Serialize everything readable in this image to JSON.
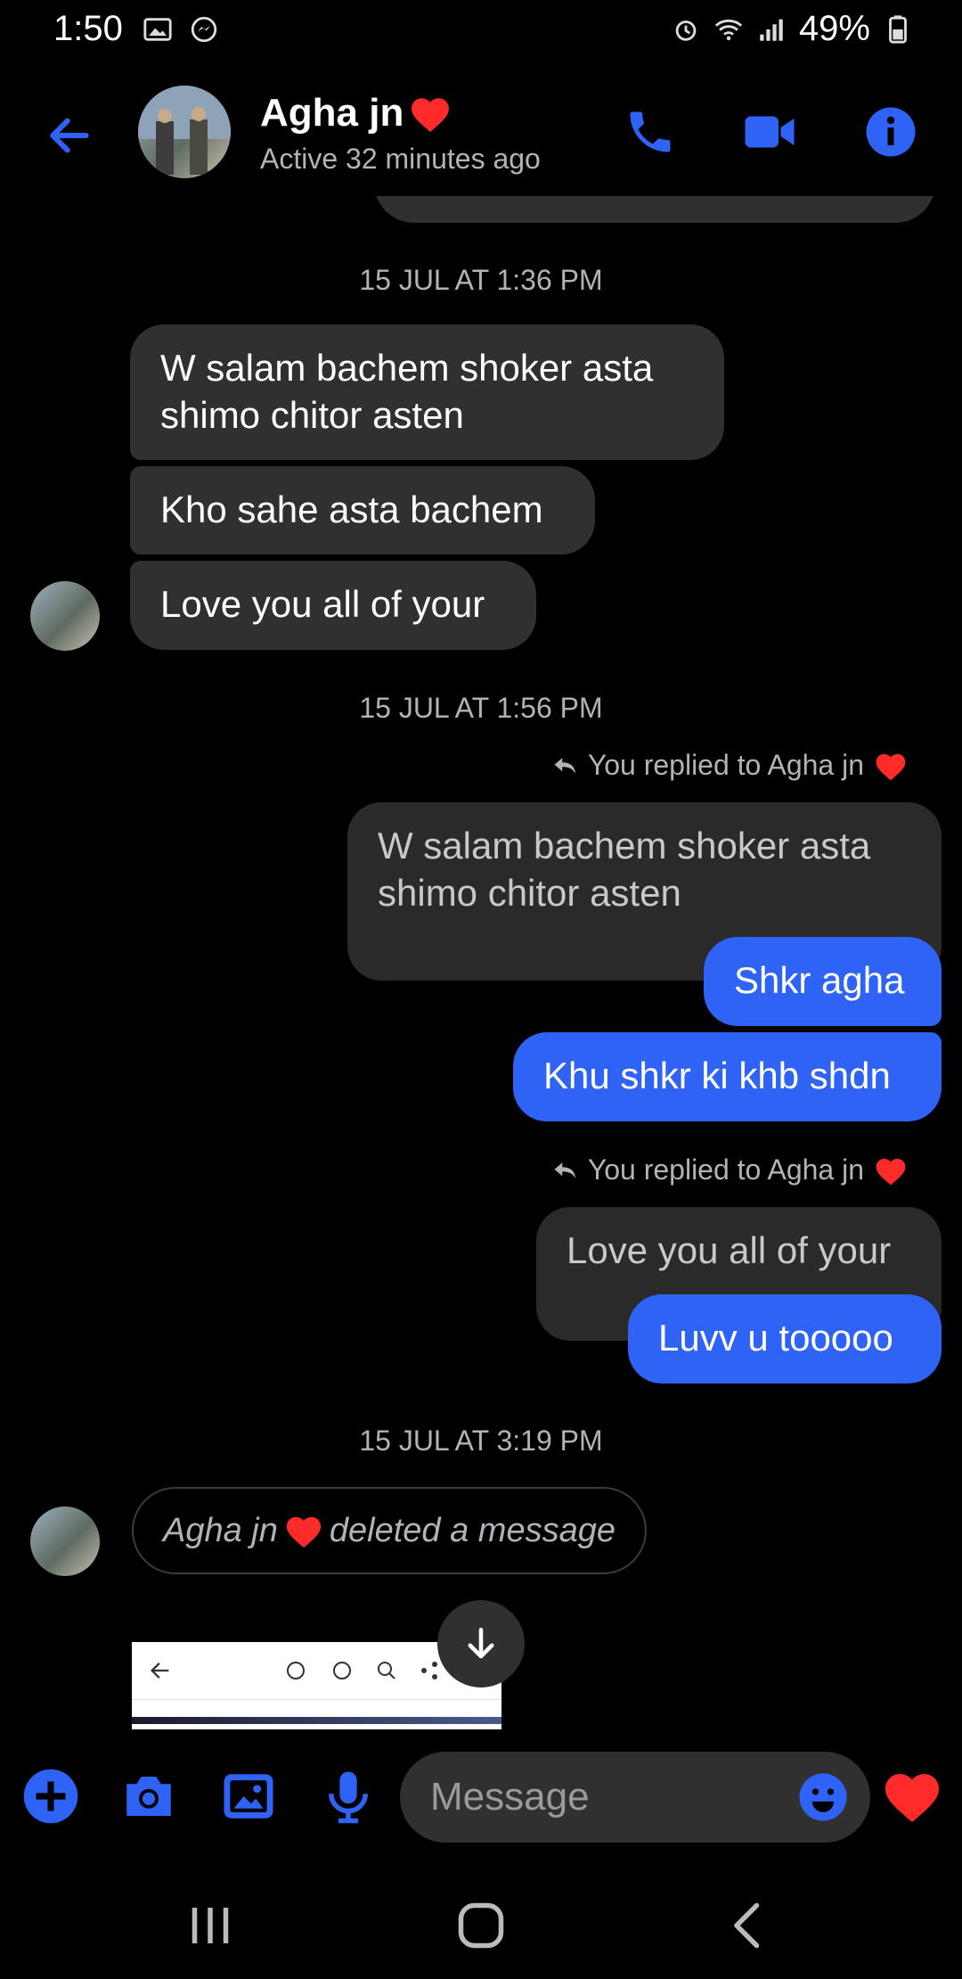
{
  "status_bar": {
    "time": "1:50",
    "battery": "49%"
  },
  "header": {
    "name": "Agha jn",
    "status": "Active 32 minutes ago"
  },
  "colors": {
    "accent": "#2e63f5",
    "incoming_bubble": "#303030",
    "background": "#000000",
    "heart": "#ff2a2a"
  },
  "messages": {
    "ts1": "15 JUL AT 1:36 PM",
    "in1": "W salam bachem  shoker asta shimo chitor asten",
    "in2": "Kho sahe asta bachem",
    "in3": "Love you all of your",
    "ts2": "15 JUL AT 1:56 PM",
    "reply1_label": "You replied to Agha jn",
    "reply1_quote": "W salam bachem  shoker asta shimo chitor asten",
    "out1": "Shkr agha",
    "out2": "Khu shkr ki khb shdn",
    "reply2_label": "You replied to Agha jn",
    "reply2_quote": "Love you all of your",
    "out3": "Luvv u tooooo",
    "ts3": "15 JUL AT 3:19 PM",
    "deleted_name": "Agha jn",
    "deleted_text": "deleted a message"
  },
  "composer": {
    "placeholder": "Message"
  },
  "icons": [
    "back-arrow-icon",
    "phone-icon",
    "video-icon",
    "info-icon",
    "plus-icon",
    "camera-icon",
    "gallery-icon",
    "mic-icon",
    "emoji-icon",
    "heart-icon",
    "reply-icon",
    "arrow-down-icon",
    "recents-icon",
    "home-icon",
    "nav-back-icon"
  ]
}
